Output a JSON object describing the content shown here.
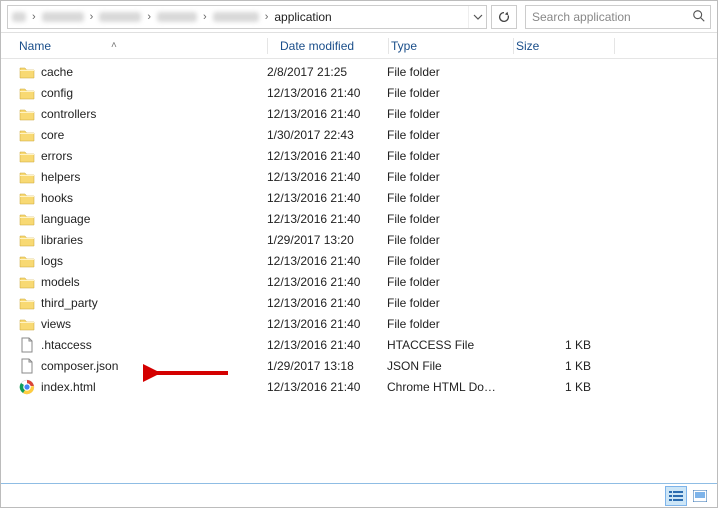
{
  "breadcrumb": {
    "current": "application",
    "separator": "›"
  },
  "search": {
    "placeholder": "Search application"
  },
  "columns": {
    "name": "Name",
    "date": "Date modified",
    "type": "Type",
    "size": "Size"
  },
  "type_labels": {
    "folder": "File folder",
    "htaccess": "HTACCESS File",
    "json": "JSON File",
    "chrome": "Chrome HTML Do…"
  },
  "items": [
    {
      "icon": "folder",
      "name": "cache",
      "date": "2/8/2017 21:25",
      "type": "File folder",
      "size": ""
    },
    {
      "icon": "folder",
      "name": "config",
      "date": "12/13/2016 21:40",
      "type": "File folder",
      "size": ""
    },
    {
      "icon": "folder",
      "name": "controllers",
      "date": "12/13/2016 21:40",
      "type": "File folder",
      "size": ""
    },
    {
      "icon": "folder",
      "name": "core",
      "date": "1/30/2017 22:43",
      "type": "File folder",
      "size": ""
    },
    {
      "icon": "folder",
      "name": "errors",
      "date": "12/13/2016 21:40",
      "type": "File folder",
      "size": ""
    },
    {
      "icon": "folder",
      "name": "helpers",
      "date": "12/13/2016 21:40",
      "type": "File folder",
      "size": ""
    },
    {
      "icon": "folder",
      "name": "hooks",
      "date": "12/13/2016 21:40",
      "type": "File folder",
      "size": ""
    },
    {
      "icon": "folder",
      "name": "language",
      "date": "12/13/2016 21:40",
      "type": "File folder",
      "size": ""
    },
    {
      "icon": "folder",
      "name": "libraries",
      "date": "1/29/2017 13:20",
      "type": "File folder",
      "size": ""
    },
    {
      "icon": "folder",
      "name": "logs",
      "date": "12/13/2016 21:40",
      "type": "File folder",
      "size": ""
    },
    {
      "icon": "folder",
      "name": "models",
      "date": "12/13/2016 21:40",
      "type": "File folder",
      "size": ""
    },
    {
      "icon": "folder",
      "name": "third_party",
      "date": "12/13/2016 21:40",
      "type": "File folder",
      "size": ""
    },
    {
      "icon": "folder",
      "name": "views",
      "date": "12/13/2016 21:40",
      "type": "File folder",
      "size": ""
    },
    {
      "icon": "file",
      "name": ".htaccess",
      "date": "12/13/2016 21:40",
      "type": "HTACCESS File",
      "size": "1 KB"
    },
    {
      "icon": "file",
      "name": "composer.json",
      "date": "1/29/2017 13:18",
      "type": "JSON File",
      "size": "1 KB"
    },
    {
      "icon": "chrome",
      "name": "index.html",
      "date": "12/13/2016 21:40",
      "type": "Chrome HTML Do…",
      "size": "1 KB"
    }
  ],
  "annotation": {
    "arrow_target_index": 14
  }
}
